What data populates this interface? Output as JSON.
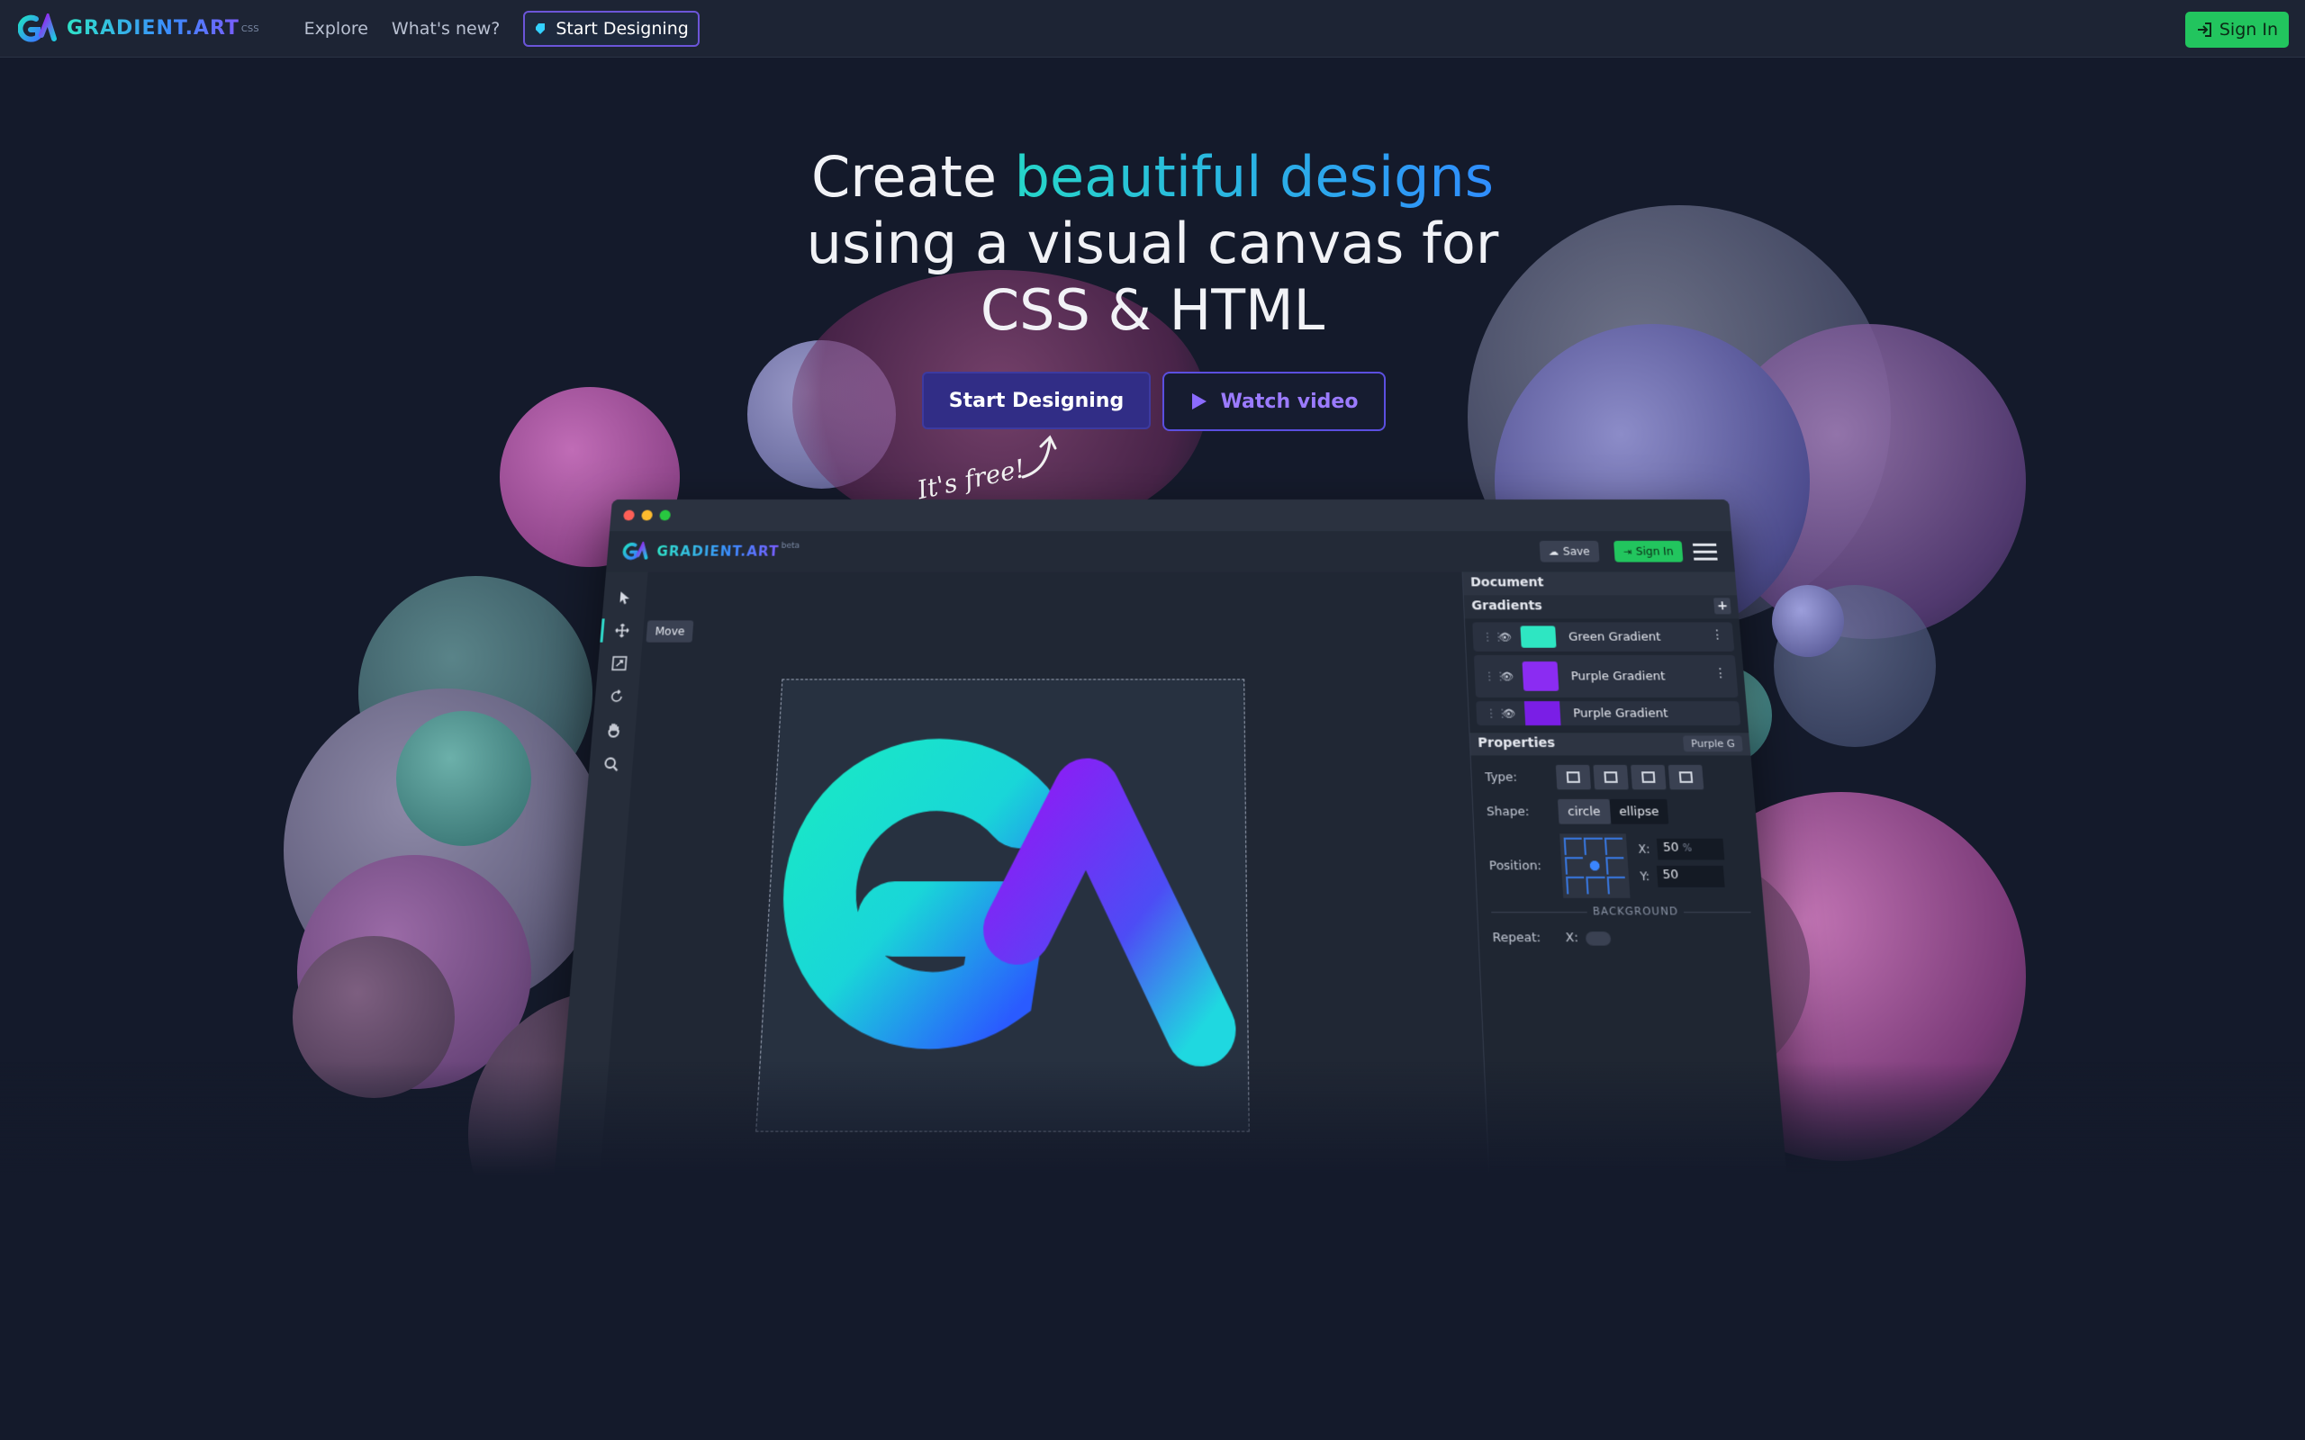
{
  "nav": {
    "brand_name": "GRADIENT.ART",
    "brand_sup": "CSS",
    "links": [
      "Explore",
      "What's new?"
    ],
    "start_label": "Start Designing",
    "signin_label": "Sign In"
  },
  "hero": {
    "line1_plain": "Create ",
    "line1_accent": "beautiful designs",
    "line2": "using a visual canvas for",
    "line3": "CSS & HTML",
    "cta_primary": "Start Designing",
    "cta_secondary": "Watch video",
    "free_note": "It's free!"
  },
  "mock": {
    "brand_name": "GRADIENT.ART",
    "brand_sup": "beta",
    "save_label": "Save",
    "signin_label": "Sign In",
    "tooltip": "Move",
    "panel_document": "Document",
    "panel_gradients": "Gradients",
    "gradients": [
      {
        "label": "Green Gradient",
        "color": "#2ee6c2"
      },
      {
        "label": "Purple Gradient",
        "color": "#8b2cf2"
      },
      {
        "label": "Purple Gradient",
        "color": "#7a1ee6"
      }
    ],
    "properties_label": "Properties",
    "properties_tag": "Purple G",
    "type_label": "Type:",
    "shape_label": "Shape:",
    "shape_options": [
      "circle",
      "ellipse"
    ],
    "position_label": "Position:",
    "x_label": "X:",
    "x_value": "50",
    "x_unit": "%",
    "y_label": "Y:",
    "y_value": "50",
    "background_label": "BACKGROUND",
    "repeat_label": "Repeat:",
    "repeat_x": "X:"
  },
  "colors": {
    "accent_teal": "#26d6c9",
    "accent_blue": "#2f8dff",
    "accent_purple": "#7a5cff",
    "signin_green": "#22c55e",
    "page_bg": "#141a2b"
  }
}
